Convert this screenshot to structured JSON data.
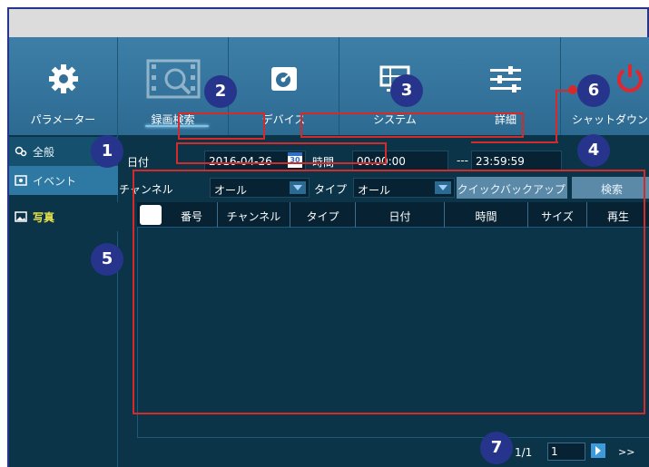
{
  "top_menu": [
    {
      "label": "パラメーター",
      "icon": "gear-icon"
    },
    {
      "label": "録画検索",
      "icon": "film-search-icon"
    },
    {
      "label": "デバイス",
      "icon": "hdd-icon"
    },
    {
      "label": "システム",
      "icon": "monitor-icon"
    },
    {
      "label": "詳細",
      "icon": "sliders-icon"
    },
    {
      "label": "シャットダウン",
      "icon": "power-icon"
    }
  ],
  "sidebar": [
    {
      "label": "全般",
      "icon": "search-settings-icon"
    },
    {
      "label": "イベント",
      "icon": "event-icon"
    },
    {
      "label": "写真",
      "icon": "photo-icon"
    }
  ],
  "filters": {
    "date_label": "日付",
    "date_value": "2016-04-26",
    "calendar_day": "30",
    "time_label": "時間",
    "time_start": "00:00:00",
    "time_sep": "---",
    "time_end": "23:59:59",
    "channel_label": "チャンネル",
    "channel_value": "オール",
    "type_label": "タイプ",
    "type_value": "オール",
    "quick_backup_label": "クイックバックアップ",
    "search_label": "検索"
  },
  "table": {
    "columns": [
      "番号",
      "チャンネル",
      "タイプ",
      "日付",
      "時間",
      "サイズ",
      "再生"
    ]
  },
  "pager": {
    "page_info": "1/1",
    "page_input": "1",
    "next_label": ">>"
  },
  "markers": [
    "1",
    "2",
    "3",
    "4",
    "5",
    "6",
    "7"
  ],
  "colors": {
    "annotation_red": "#d42a2a",
    "marker_blue": "#27348b",
    "selected_text": "#e8e44a"
  }
}
